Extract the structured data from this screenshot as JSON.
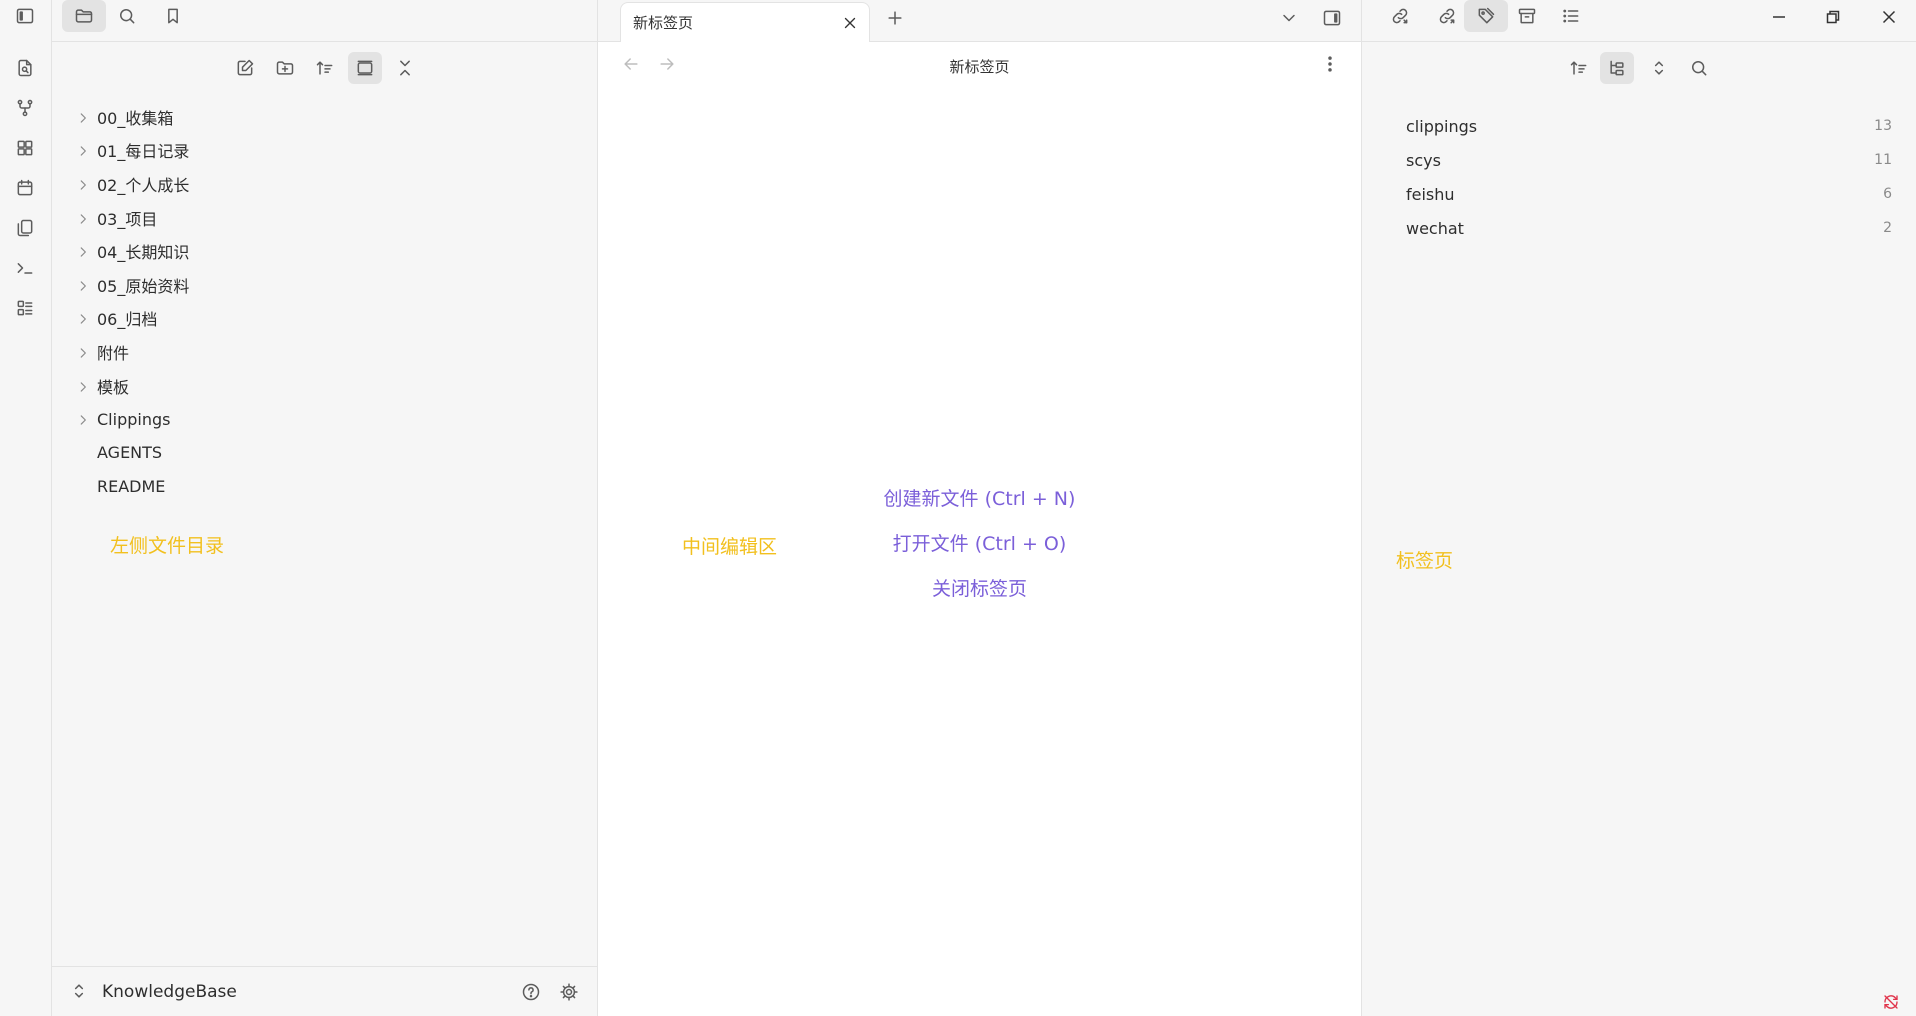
{
  "ribbon": {
    "icons": [
      "sidebar-toggle-icon",
      "quick-switch-icon",
      "graph-view-icon",
      "canvas-icon",
      "daily-notes-icon",
      "templates-icon",
      "command-palette-icon",
      "bases-icon"
    ]
  },
  "left_sidebar": {
    "tab_icons": [
      "file-explorer-icon",
      "search-icon",
      "bookmarks-icon"
    ],
    "toolbar_icons": [
      "new-note-icon",
      "new-folder-icon",
      "sort-icon",
      "auto-reveal-icon",
      "collapse-all-icon"
    ],
    "tree": [
      {
        "label": "00_收集箱",
        "folder": true
      },
      {
        "label": "01_每日记录",
        "folder": true
      },
      {
        "label": "02_个人成长",
        "folder": true
      },
      {
        "label": "03_项目",
        "folder": true
      },
      {
        "label": "04_长期知识",
        "folder": true
      },
      {
        "label": "05_原始资料",
        "folder": true
      },
      {
        "label": "06_归档",
        "folder": true
      },
      {
        "label": "附件",
        "folder": true
      },
      {
        "label": "模板",
        "folder": true
      },
      {
        "label": "Clippings",
        "folder": true
      },
      {
        "label": "AGENTS",
        "folder": false
      },
      {
        "label": "README",
        "folder": false
      }
    ],
    "annotation": "左侧文件目录",
    "vault_name": "KnowledgeBase"
  },
  "center": {
    "tab_title": "新标签页",
    "header_title": "新标签页",
    "actions": {
      "new_file": "创建新文件 (Ctrl + N)",
      "open_file": "打开文件 (Ctrl + O)",
      "close_tab": "关闭标签页"
    },
    "annotation": "中间编辑区"
  },
  "right_sidebar": {
    "tab_icons": [
      "backlinks-icon",
      "outgoing-links-icon",
      "tags-icon",
      "archive-icon",
      "outline-icon"
    ],
    "toolbar_icons": [
      "sort-icon",
      "tree-view-icon",
      "expand-collapse-icon",
      "search-icon"
    ],
    "tags": [
      {
        "name": "clippings",
        "count": "13"
      },
      {
        "name": "scys",
        "count": "11"
      },
      {
        "name": "feishu",
        "count": "6"
      },
      {
        "name": "wechat",
        "count": "2"
      }
    ],
    "annotation": "标签页"
  },
  "colors": {
    "accent": "#7b5fd9",
    "annotation": "#f2c01e",
    "sidebar_bg": "#f6f6f6",
    "editor_bg": "#ffffff"
  }
}
